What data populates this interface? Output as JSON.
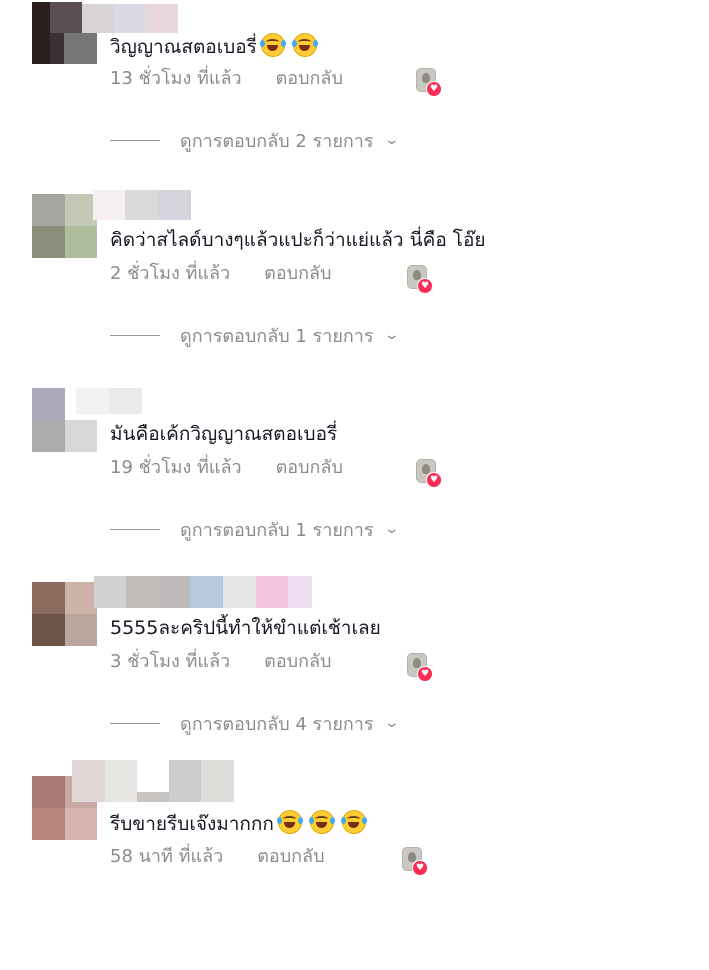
{
  "comments": [
    {
      "text": "วิญญาณสตอเบอรี่",
      "emoji": [
        "laughing-crying-emoji",
        "laughing-crying-emoji"
      ],
      "time": "13 ชั่วโมง ที่แล้ว",
      "reply_label": "ตอบกลับ",
      "view_replies": "ดูการตอบกลับ 2 รายการ",
      "colors": [
        "#2a1e1e",
        "#5b4e50",
        "#d8d4d6",
        "#dcd8e6",
        "#e8d6dc",
        "#3a3236",
        "#777777"
      ]
    },
    {
      "text": "คิดว่าสไลด์บางๆแล้วแปะก็ว่าแย่แล้ว นี่คือ โอ๊ย",
      "emoji": [],
      "time": "2 ชั่วโมง ที่แล้ว",
      "reply_label": "ตอบกลับ",
      "view_replies": "ดูการตอบกลับ 1 รายการ",
      "colors": [
        "#a7a6a2",
        "#c3c9b5",
        "#f5efef",
        "#dadada",
        "#d3d4dc",
        "#8a8f7c",
        "#aebd9c"
      ]
    },
    {
      "text": "มันคือเค้กวิญญาณสตอเบอรี่",
      "emoji": [],
      "time": "19 ชั่วโมง ที่แล้ว",
      "reply_label": "ตอบกลับ",
      "view_replies": "ดูการตอบกลับ 1 รายการ",
      "colors": [
        "#a9a9bb",
        "#f2f2f4",
        "#ebebeb",
        "#acacaf",
        "#d7d7da"
      ]
    },
    {
      "text": "5555ละคริปนี้ทำให้ขำแต่เช้าเลย",
      "emoji": [],
      "time": "3 ชั่วโมง ที่แล้ว",
      "reply_label": "ตอบกลับ",
      "view_replies": "ดูการตอบกลับ 4 รายการ",
      "colors": [
        "#8c6a5d",
        "#cdb3a8",
        "#d1d0d2",
        "#c1bcb8",
        "#bebbba",
        "#b6c9df",
        "#e5e5e8",
        "#f3c5dd",
        "#eedcf0",
        "#6e5349",
        "#b9a59b"
      ]
    },
    {
      "text": "รีบขายรีบเจ๊งมากกก",
      "emoji": [
        "laughing-crying-emoji",
        "laughing-crying-emoji",
        "laughing-crying-emoji"
      ],
      "time": "58 นาที ที่แล้ว",
      "reply_label": "ตอบกลับ",
      "view_replies": "",
      "colors": [
        "#a67a73",
        "#c9a7a3",
        "#e0d6d6",
        "#e6e5e2",
        "#cdcdcd",
        "#dedcd8",
        "#c7c4c2",
        "#b8857f",
        "#d9b3b0"
      ]
    }
  ]
}
